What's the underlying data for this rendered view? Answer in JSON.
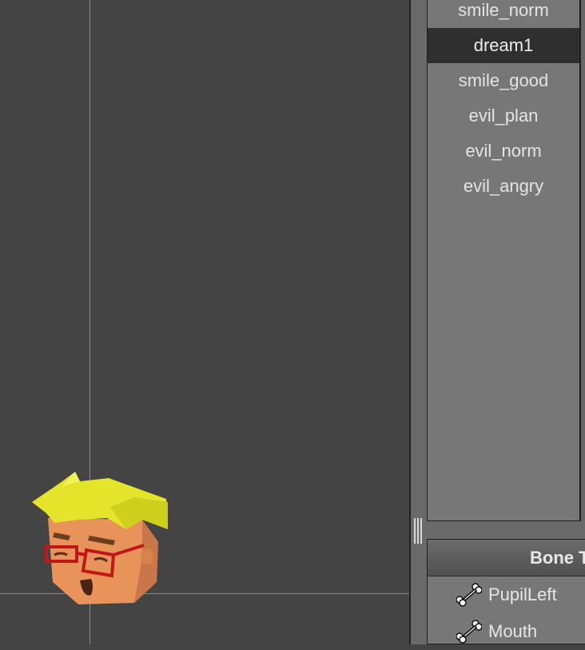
{
  "animations": {
    "items": [
      "smile_norm",
      "dream1",
      "smile_good",
      "evil_plan",
      "evil_norm",
      "evil_angry"
    ],
    "selected": "dream1"
  },
  "bone_panel": {
    "title": "Bone T",
    "items": [
      {
        "label": "PupilLeft",
        "icon": "bone-icon"
      },
      {
        "label": "Mouth",
        "icon": "bone-icon"
      }
    ]
  },
  "colors": {
    "canvas_bg": "#444444",
    "list_bg": "#777777",
    "selected_bg": "#2f2f2f",
    "hair": "#e4e42a",
    "skin": "#e8935a",
    "glasses": "#c01818"
  }
}
